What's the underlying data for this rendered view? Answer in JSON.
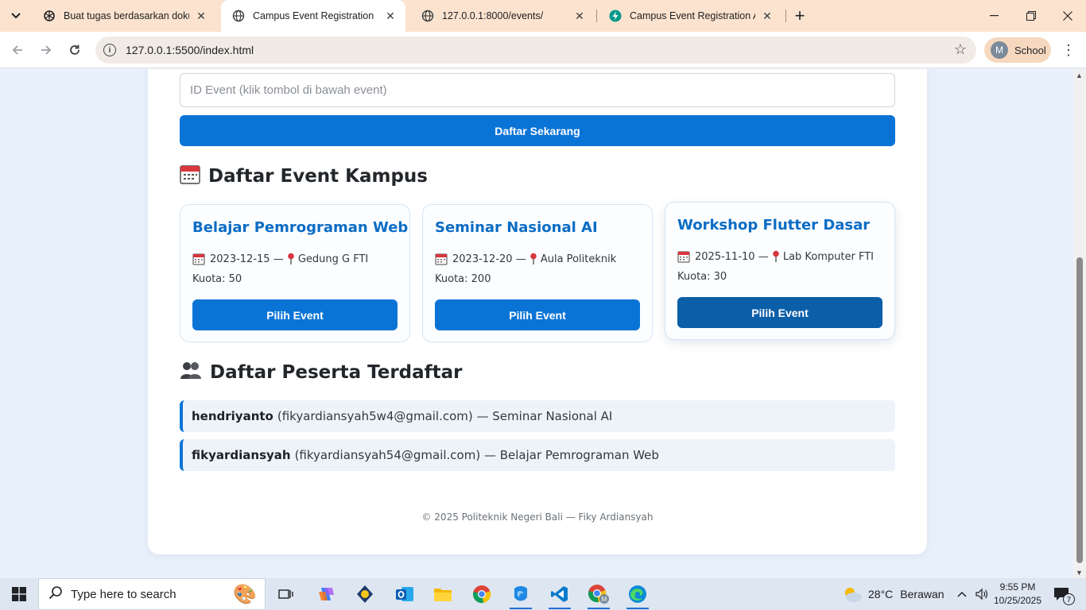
{
  "browser": {
    "tabs": [
      {
        "title": "Buat tugas berdasarkan dokum",
        "icon": "openai-icon",
        "active": false
      },
      {
        "title": "Campus Event Registration",
        "icon": "globe-icon",
        "active": true
      },
      {
        "title": "127.0.0.1:8000/events/",
        "icon": "globe-icon",
        "active": false
      },
      {
        "title": "Campus Event Registration API",
        "icon": "fastapi-icon",
        "active": false
      }
    ],
    "url": "127.0.0.1:5500/index.html",
    "profile": {
      "initial": "M",
      "name": "School"
    }
  },
  "form": {
    "event_id_placeholder": "ID Event (klik tombol di bawah event)",
    "event_id_value": "",
    "submit_label": "Daftar Sekarang"
  },
  "events_section": {
    "icon": "calendar-icon",
    "title": "Daftar Event Kampus",
    "events": [
      {
        "title": "Belajar Pemrograman Web",
        "date": "2023-12-15",
        "separator": "—",
        "location": "Gedung G FTI",
        "quota": "Kuota: 50",
        "button": "Pilih Event"
      },
      {
        "title": "Seminar Nasional AI",
        "date": "2023-12-20",
        "separator": "—",
        "location": "Aula Politeknik",
        "quota": "Kuota: 200",
        "button": "Pilih Event"
      },
      {
        "title": "Workshop Flutter Dasar",
        "date": "2025-11-10",
        "separator": "—",
        "location": "Lab Komputer FTI",
        "quota": "Kuota: 30",
        "button": "Pilih Event"
      }
    ]
  },
  "participants_section": {
    "icon": "people-icon",
    "title": "Daftar Peserta Terdaftar",
    "participants": [
      {
        "name": "hendriyanto",
        "detail": "(fikyardiansyah5w4@gmail.com) — Seminar Nasional AI"
      },
      {
        "name": "fikyardiansyah",
        "detail": "(fikyardiansyah54@gmail.com) — Belajar Pemrograman Web"
      }
    ]
  },
  "footer": {
    "text": "© 2025 Politeknik Negeri Bali — Fiky Ardiansyah"
  },
  "taskbar": {
    "search_placeholder": "Type here to search",
    "weather": {
      "temp": "28°C",
      "condition": "Berawan"
    },
    "time": "9:55 PM",
    "date": "10/25/2025",
    "notification_count": "7"
  },
  "colors": {
    "accent": "#0a74d6",
    "title_blue": "#0b6cc4",
    "page_bg": "#e8f1fb",
    "tab_bar": "#fbe3cf"
  }
}
